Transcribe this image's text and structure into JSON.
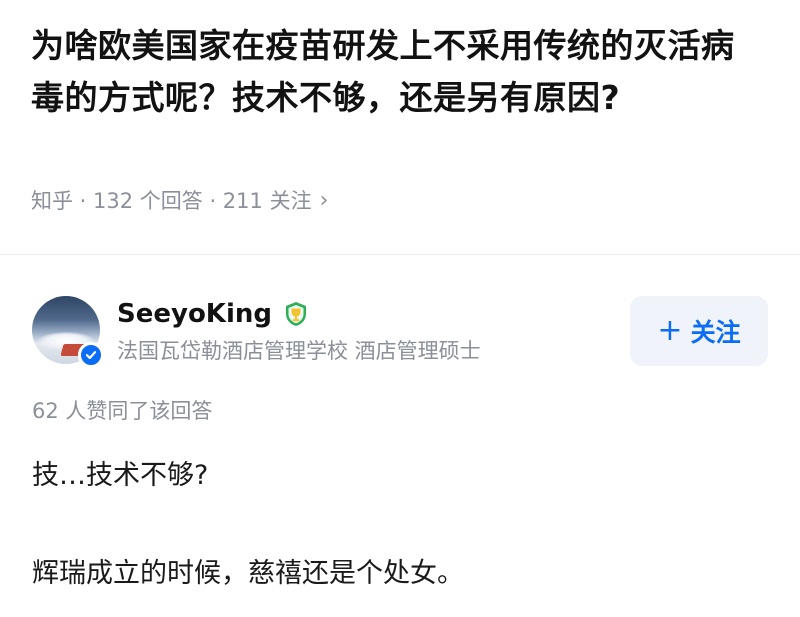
{
  "question": {
    "title": "为啥欧美国家在疫苗研发上不采用传统的灭活病毒的方式呢？技术不够，还是另有原因?",
    "meta": "知乎 · 132 个回答 · 211 关注",
    "chevron": "›"
  },
  "author": {
    "name": "SeeyoKing",
    "bio": "法国瓦岱勒酒店管理学校 酒店管理硕士",
    "avatar_icon": "avatar-image",
    "badge_icon": "verified-check-icon",
    "medal_icon": "medal-icon"
  },
  "follow": {
    "plus": "+",
    "label": "关注"
  },
  "answer": {
    "upvotes": "62 人赞同了该回答",
    "paragraphs": [
      "技…技术不够?",
      "辉瑞成立的时候，慈禧还是个处女。"
    ]
  },
  "colors": {
    "accent": "#0b6cf5",
    "meta": "#8a8f99",
    "text": "#121212",
    "follow_bg": "#f0f4fa",
    "medal_green": "#2fae5a",
    "medal_gold": "#f2c230"
  }
}
